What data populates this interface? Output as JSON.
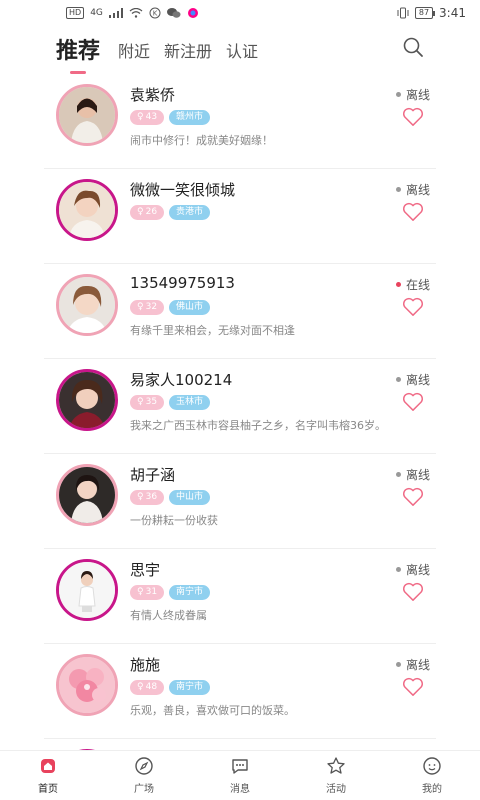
{
  "status_bar": {
    "time": "3:41",
    "battery": "87",
    "hd": "HD",
    "signal": "4G"
  },
  "top_tabs": [
    {
      "label": "推荐",
      "active": true
    },
    {
      "label": "附近",
      "active": false
    },
    {
      "label": "新注册",
      "active": false
    },
    {
      "label": "认证",
      "active": false
    }
  ],
  "icons": {
    "search": "search-icon",
    "heart": "heart-outline-icon",
    "female": "female-symbol-icon"
  },
  "colors": {
    "accent": "#f06a86",
    "age_badge": "#f7c1d0",
    "city_badge": "#8fd0ef",
    "online_dot": "#e8425d",
    "avatar_ring": "#c8168a"
  },
  "users": [
    {
      "name": "袁紫侨",
      "age": "43",
      "city": "赣州市",
      "signature": "闹市中修行！成就美好姻缘！",
      "status": "离线",
      "online": false,
      "ring": "pink"
    },
    {
      "name": "微微一笑很倾城",
      "age": "26",
      "city": "贵港市",
      "signature": "",
      "status": "离线",
      "online": false,
      "ring": "purple"
    },
    {
      "name": "13549975913",
      "age": "32",
      "city": "佛山市",
      "signature": "有缘千里来相会，无缘对面不相逢",
      "status": "在线",
      "online": true,
      "ring": "pink"
    },
    {
      "name": "易家人100214",
      "age": "35",
      "city": "玉林市",
      "signature": "我来之广西玉林市容县柚子之乡，名字叫韦榕36岁。",
      "status": "离线",
      "online": false,
      "ring": "purple"
    },
    {
      "name": "胡子涵",
      "age": "36",
      "city": "中山市",
      "signature": "一份耕耘一份收获",
      "status": "离线",
      "online": false,
      "ring": "pink"
    },
    {
      "name": "思宇",
      "age": "31",
      "city": "南宁市",
      "signature": "有情人终成眷属",
      "status": "离线",
      "online": false,
      "ring": "purple"
    },
    {
      "name": "施施",
      "age": "48",
      "city": "南宁市",
      "signature": "乐观，善良，喜欢做可口的饭菜。",
      "status": "离线",
      "online": false,
      "ring": "pink"
    }
  ],
  "bottom_nav": [
    {
      "label": "首页",
      "icon": "home-icon",
      "active": true
    },
    {
      "label": "广场",
      "icon": "compass-icon",
      "active": false
    },
    {
      "label": "消息",
      "icon": "message-bubble-icon",
      "active": false
    },
    {
      "label": "活动",
      "icon": "star-icon",
      "active": false
    },
    {
      "label": "我的",
      "icon": "user-face-icon",
      "active": false
    }
  ]
}
